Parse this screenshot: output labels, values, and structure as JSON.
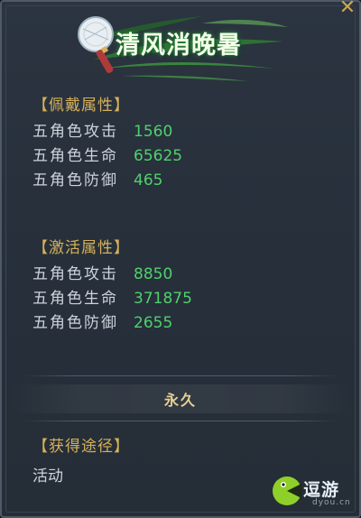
{
  "title": "清风消晚暑",
  "close_glyph": "✕",
  "worn_attributes": {
    "heading": "【佩戴属性】",
    "rows": [
      {
        "label": "五角色攻击",
        "value": "1560"
      },
      {
        "label": "五角色生命",
        "value": "65625"
      },
      {
        "label": "五角色防御",
        "value": "465"
      }
    ]
  },
  "active_attributes": {
    "heading": "【激活属性】",
    "rows": [
      {
        "label": "五角色攻击",
        "value": "8850"
      },
      {
        "label": "五角色生命",
        "value": "371875"
      },
      {
        "label": "五角色防御",
        "value": "2655"
      }
    ]
  },
  "duration": "永久",
  "obtain": {
    "heading": "【获得途径】",
    "value": "活动"
  },
  "watermark": {
    "text": "逗游",
    "url": "dyou.cn"
  },
  "colors": {
    "heading": "#d6b15a",
    "value": "#4fd16d",
    "label": "#cdd3da",
    "duration": "#e8cf93"
  },
  "icons": [
    "fan-icon",
    "bamboo-leaf-icon",
    "close-icon",
    "watermark-logo-icon"
  ]
}
